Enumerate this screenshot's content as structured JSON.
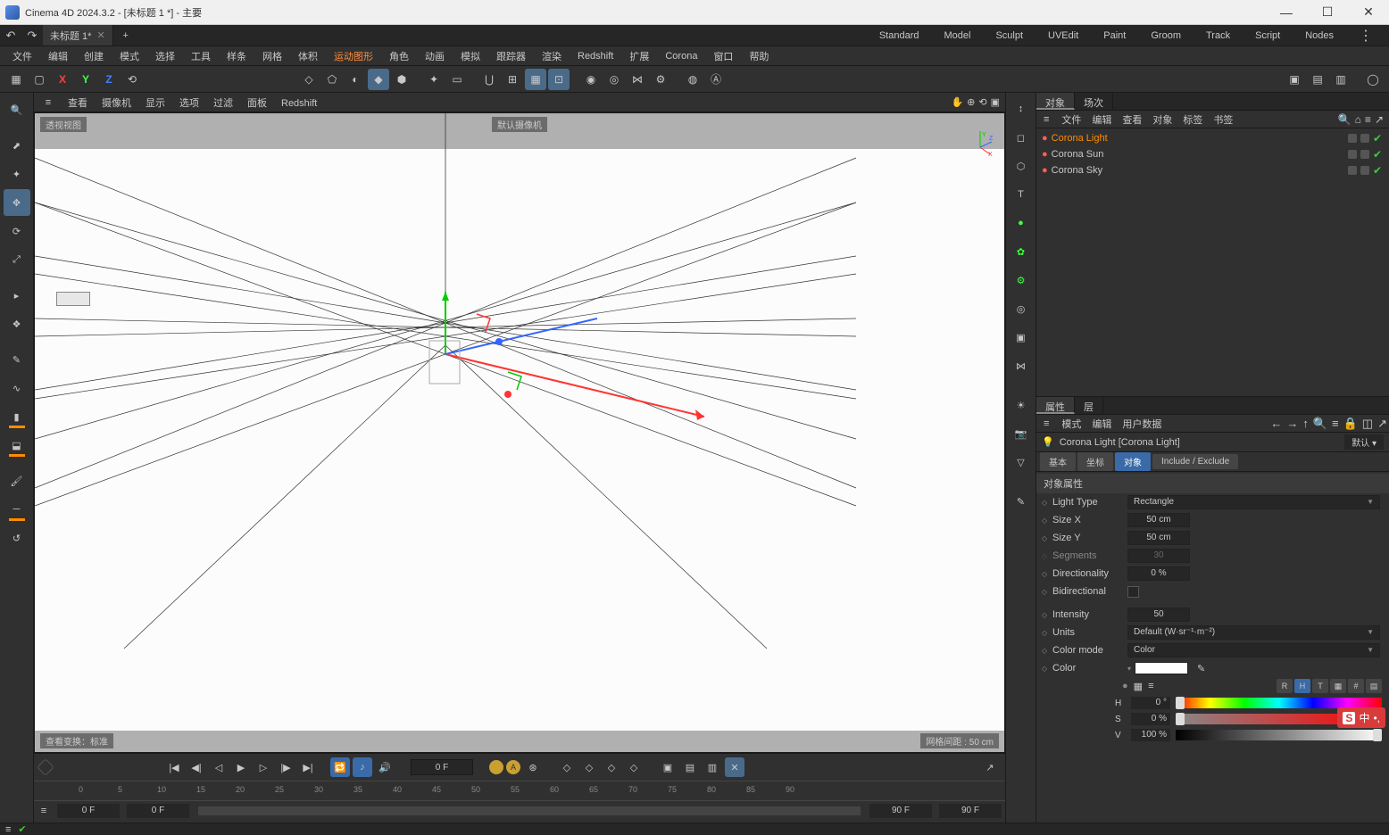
{
  "title": "Cinema 4D 2024.3.2 - [未标题 1 *] - 主要",
  "doc_tab": "未标题 1*",
  "layouts": [
    "Standard",
    "Model",
    "Sculpt",
    "UVEdit",
    "Paint",
    "Groom",
    "Track",
    "Script",
    "Nodes"
  ],
  "menus": [
    "文件",
    "编辑",
    "创建",
    "模式",
    "选择",
    "工具",
    "样条",
    "网格",
    "体积",
    "运动图形",
    "角色",
    "动画",
    "模拟",
    "跟踪器",
    "渲染",
    "Redshift",
    "扩展",
    "Corona",
    "窗口",
    "帮助"
  ],
  "hot_menu_index": 9,
  "viewport": {
    "menus": [
      "查看",
      "摄像机",
      "显示",
      "选项",
      "过滤",
      "面板",
      "Redshift"
    ],
    "tl": "透视视图",
    "tc": "默认摄像机",
    "bl": "查看变换：标准",
    "br": "网格间距 : 50 cm"
  },
  "timeline": {
    "frame": "0 F",
    "start": "0 F",
    "pstart": "0 F",
    "end": "90 F",
    "pend": "90 F",
    "ticks": [
      0,
      5,
      10,
      15,
      20,
      25,
      30,
      35,
      40,
      45,
      50,
      55,
      60,
      65,
      70,
      75,
      80,
      85,
      90
    ]
  },
  "obj_panel": {
    "tabs": [
      "对象",
      "场次"
    ],
    "active_tab_index": 0,
    "menus": [
      "文件",
      "编辑",
      "查看",
      "对象",
      "标签",
      "书签"
    ],
    "objects": [
      {
        "name": "Corona Light",
        "color": "#ff6050",
        "selected": true
      },
      {
        "name": "Corona Sun",
        "color": "#ff6050",
        "selected": false
      },
      {
        "name": "Corona Sky",
        "color": "#ff6050",
        "selected": false
      }
    ]
  },
  "attr": {
    "tabs": [
      "属性",
      "层"
    ],
    "menus": [
      "模式",
      "编辑",
      "用户数据"
    ],
    "object_line": "Corona Light [Corona Light]",
    "preset": "默认",
    "sub_tabs": [
      "基本",
      "坐标",
      "对象",
      "Include / Exclude"
    ],
    "active_sub_tab": 2,
    "section": "对象属性",
    "props": {
      "light_type_label": "Light Type",
      "light_type": "Rectangle",
      "sizex_label": "Size X",
      "sizex": "50 cm",
      "sizey_label": "Size Y",
      "sizey": "50 cm",
      "segments_label": "Segments",
      "segments": "30",
      "direction_label": "Directionality",
      "direction": "0 %",
      "bidir_label": "Bidirectional",
      "intensity_label": "Intensity",
      "intensity": "50",
      "units_label": "Units",
      "units": "Default (W·sr⁻¹·m⁻²)",
      "colormode_label": "Color mode",
      "colormode": "Color",
      "color_label": "Color",
      "h_label": "H",
      "h": "0 °",
      "s_label": "S",
      "s": "0 %",
      "v_label": "V",
      "v": "100 %"
    },
    "color_modes": [
      "R",
      "H",
      "T"
    ]
  },
  "ime": "中"
}
